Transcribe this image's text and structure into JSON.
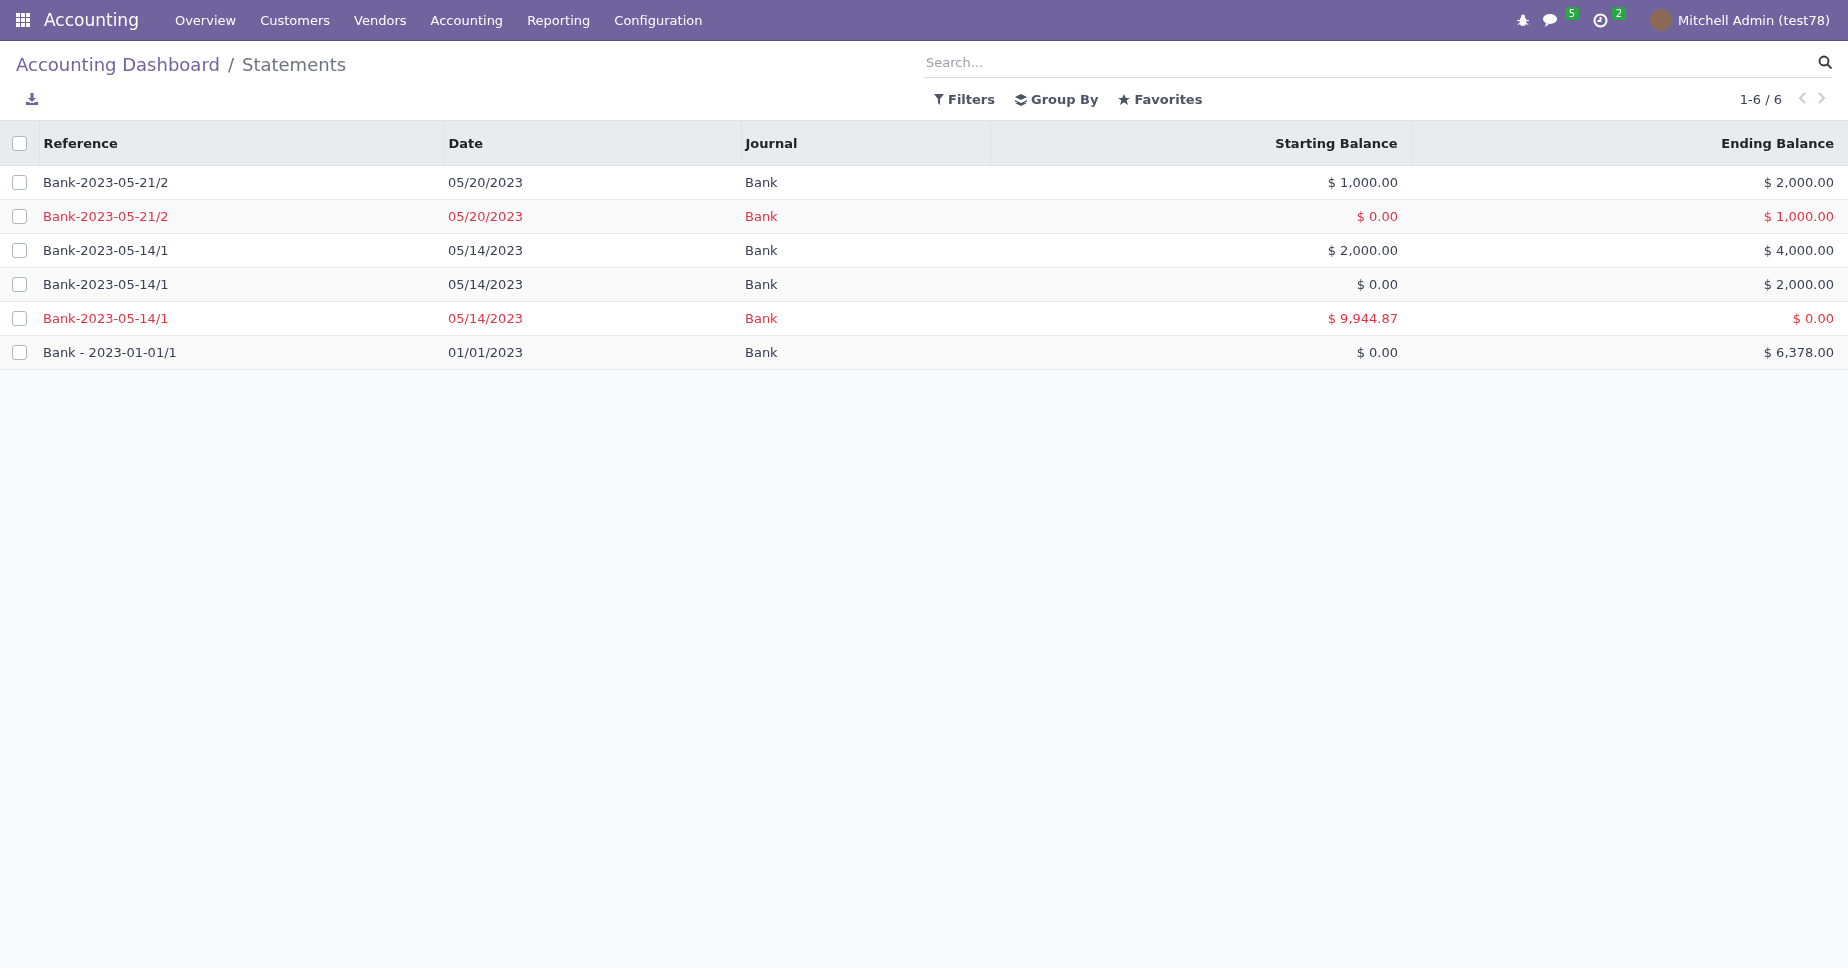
{
  "navbar": {
    "app_name": "Accounting",
    "menu": [
      "Overview",
      "Customers",
      "Vendors",
      "Accounting",
      "Reporting",
      "Configuration"
    ],
    "messages_badge": "5",
    "activities_badge": "2",
    "user": "Mitchell Admin (test78)"
  },
  "breadcrumb": {
    "parent": "Accounting Dashboard",
    "separator": "/",
    "current": "Statements"
  },
  "search": {
    "placeholder": "Search..."
  },
  "filters": [
    "Filters",
    "Group By",
    "Favorites"
  ],
  "pager": "1-6 / 6",
  "table": {
    "select_all_checked": false,
    "columns": [
      {
        "label": "Reference",
        "kind": "text"
      },
      {
        "label": "Date",
        "kind": "text"
      },
      {
        "label": "Journal",
        "kind": "text"
      },
      {
        "label": "Starting Balance",
        "kind": "amount"
      },
      {
        "label": "Ending Balance",
        "kind": "amount"
      }
    ],
    "rows": [
      {
        "checked": false,
        "flagged": false,
        "cells": [
          "Bank-2023-05-21/2",
          "05/20/2023",
          "Bank",
          "$ 1,000.00",
          "$ 2,000.00"
        ]
      },
      {
        "checked": false,
        "flagged": true,
        "cells": [
          "Bank-2023-05-21/2",
          "05/20/2023",
          "Bank",
          "$ 0.00",
          "$ 1,000.00"
        ]
      },
      {
        "checked": false,
        "flagged": false,
        "cells": [
          "Bank-2023-05-14/1",
          "05/14/2023",
          "Bank",
          "$ 2,000.00",
          "$ 4,000.00"
        ]
      },
      {
        "checked": false,
        "flagged": false,
        "cells": [
          "Bank-2023-05-14/1",
          "05/14/2023",
          "Bank",
          "$ 0.00",
          "$ 2,000.00"
        ]
      },
      {
        "checked": false,
        "flagged": true,
        "cells": [
          "Bank-2023-05-14/1",
          "05/14/2023",
          "Bank",
          "$ 9,944.87",
          "$ 0.00"
        ]
      },
      {
        "checked": false,
        "flagged": false,
        "cells": [
          "Bank - 2023-01-01/1",
          "01/01/2023",
          "Bank",
          "$ 0.00",
          "$ 6,378.00"
        ]
      }
    ]
  }
}
